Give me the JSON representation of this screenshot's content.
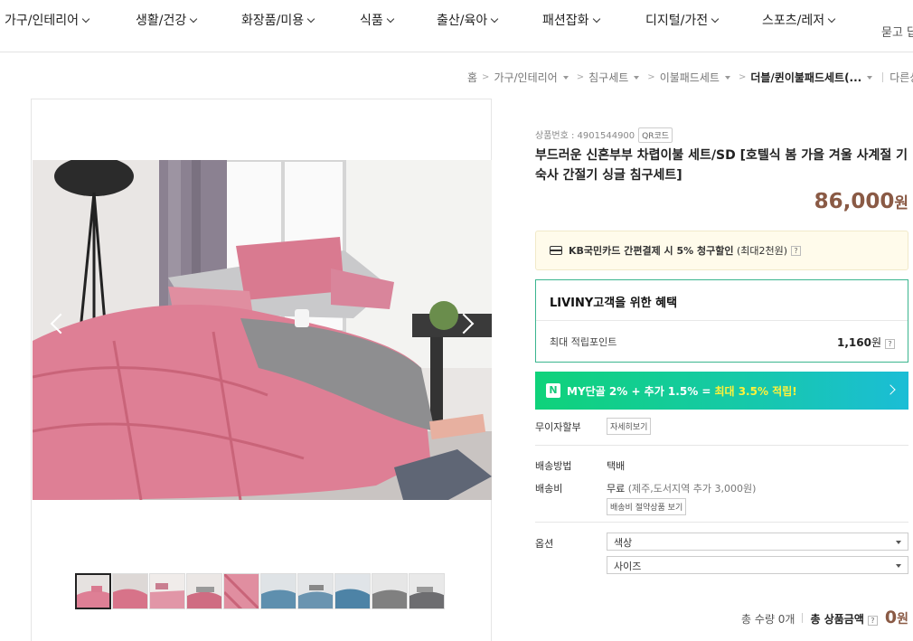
{
  "nav": {
    "items": [
      "가구/인테리어",
      "생활/건강",
      "화장품/미용",
      "식품",
      "출산/육아",
      "패션잡화",
      "디지털/가전",
      "스포츠/레저"
    ],
    "more": "묻고 답"
  },
  "breadcrumb": {
    "home": "홈",
    "level1": "가구/인테리어",
    "level2": "침구세트",
    "level3": "이불패드세트",
    "current": "더블/퀸이불패드세트(...",
    "other": "다른상"
  },
  "product": {
    "code_label": "상품번호 : 4901544900",
    "qr_label": "QR코드",
    "title": "부드러운 신혼부부 차렵이불 세트/SD [호텔식 봄 가을 겨울 사계절 기숙사 간절기 싱글 침구세트]",
    "price": "86,000",
    "price_unit": "원"
  },
  "card_discount": {
    "text": "KB국민카드 간편결제 시 5% 청구할인",
    "sub": "(최대2천원)",
    "help": "?"
  },
  "benefit": {
    "title": "LIVINY고객을 위한 혜택",
    "label": "최대 적립포인트",
    "value": "1,160",
    "unit": "원",
    "help": "?"
  },
  "promo": {
    "badge": "N",
    "text": "MY단골 2% + 추가 1.5% =",
    "highlight": "최대 3.5% 적립!"
  },
  "installment": {
    "label": "무이자할부",
    "button": "자세히보기"
  },
  "shipping": {
    "method_label": "배송방법",
    "method_value": "택배",
    "fee_label": "배송비",
    "fee_value": "무료",
    "fee_note": "(제주,도서지역 추가 3,000원)",
    "save_button": "배송비 절약상품 보기"
  },
  "options": {
    "label": "옵션",
    "color": "색상",
    "size": "사이즈"
  },
  "total": {
    "qty": "총 수량 0개",
    "label": "총 상품금액",
    "help": "?",
    "amount": "0",
    "unit": "원"
  },
  "colors": {
    "price": "#8a5a45",
    "benefit_border": "#3bb58f",
    "promo_highlight": "#fff23a"
  }
}
